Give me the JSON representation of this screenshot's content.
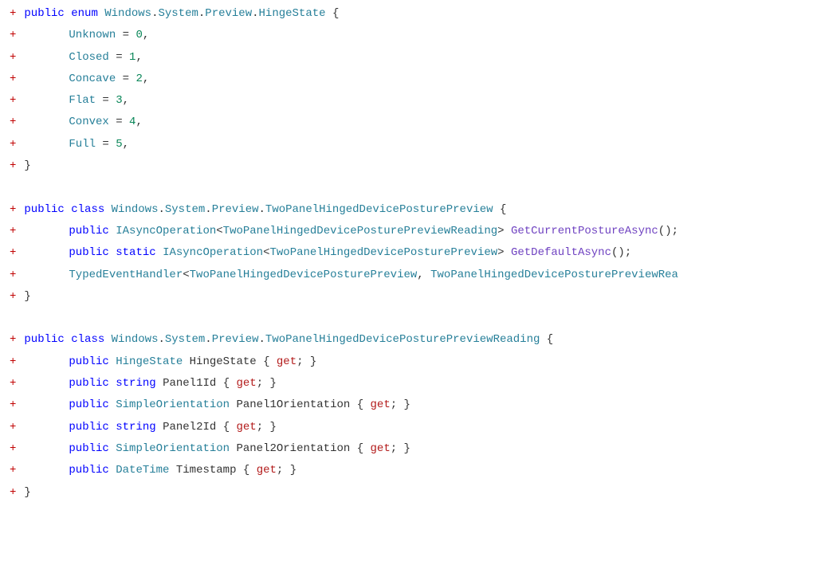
{
  "plus": "+",
  "kw": {
    "public": "public",
    "enum": "enum",
    "class": "class",
    "static": "static",
    "get": "get"
  },
  "punct": {
    "openBrace": "{",
    "closeBrace": "}",
    "comma": ",",
    "semicolon": ";",
    "lt": "<",
    "gt": ">",
    "parens": "()",
    "eq": "=",
    "dot": ".",
    "getExpr": "{ ",
    "getClose": "; }"
  },
  "ns": [
    "Windows",
    "System",
    "Preview"
  ],
  "enum": {
    "name": "HingeState",
    "members": [
      {
        "name": "Unknown",
        "value": "0"
      },
      {
        "name": "Closed",
        "value": "1"
      },
      {
        "name": "Concave",
        "value": "2"
      },
      {
        "name": "Flat",
        "value": "3"
      },
      {
        "name": "Convex",
        "value": "4"
      },
      {
        "name": "Full",
        "value": "5"
      }
    ]
  },
  "class1": {
    "name": "TwoPanelHingedDevicePosturePreview",
    "method1": {
      "retOuter": "IAsyncOperation",
      "retInner": "TwoPanelHingedDevicePosturePreviewReading",
      "name": "GetCurrentPostureAsync"
    },
    "method2": {
      "retOuter": "IAsyncOperation",
      "retInner": "TwoPanelHingedDevicePosturePreview",
      "name": "GetDefaultAsync"
    },
    "event": {
      "handler": "TypedEventHandler",
      "arg1": "TwoPanelHingedDevicePosturePreview",
      "arg2": "TwoPanelHingedDevicePosturePreviewRea"
    }
  },
  "class2": {
    "name": "TwoPanelHingedDevicePosturePreviewReading",
    "props": [
      {
        "type": "HingeState",
        "name": "HingeState"
      },
      {
        "type": "string",
        "name": "Panel1Id"
      },
      {
        "type": "SimpleOrientation",
        "name": "Panel1Orientation"
      },
      {
        "type": "string",
        "name": "Panel2Id"
      },
      {
        "type": "SimpleOrientation",
        "name": "Panel2Orientation"
      },
      {
        "type": "DateTime",
        "name": "Timestamp"
      }
    ]
  }
}
